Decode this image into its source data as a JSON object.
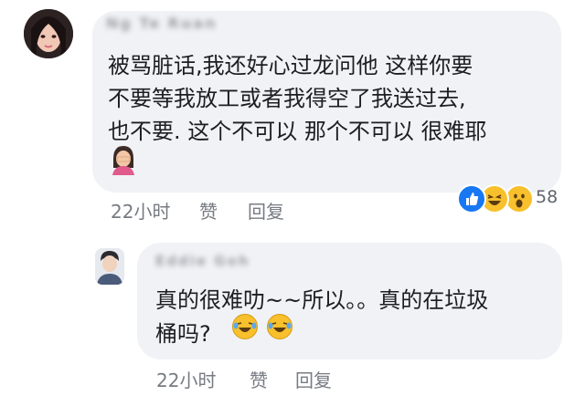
{
  "main_comment": {
    "author": "Ng Te Ruan",
    "lines": [
      "被骂脏话,我还好心过龙问他 这样你要",
      "不要等我放工或者我得空了我送过去,",
      "也不要. 这个不可以 那个不可以 很难耶"
    ],
    "emoji_icon": "woman-facepalm-emoji",
    "time": "22小时",
    "like_label": "赞",
    "reply_label": "回复",
    "reactions": {
      "icons": [
        "like-icon",
        "haha-icon",
        "wow-icon"
      ],
      "count": "58"
    }
  },
  "reply_comment": {
    "author": "Eddie Goh",
    "lines": [
      "真的很难叻~~所以。。真的在垃圾",
      "桶吗?"
    ],
    "emoji_icons": [
      "laughing-tears-emoji",
      "laughing-tears-emoji"
    ],
    "time": "22小时",
    "like_label": "赞",
    "reply_label": "回复"
  },
  "colors": {
    "bubble": "#f0f2f5",
    "text": "#1c1e21",
    "meta": "#777b82",
    "like_blue": "#1877f2",
    "emoji_yellow": "#f7c02c"
  }
}
